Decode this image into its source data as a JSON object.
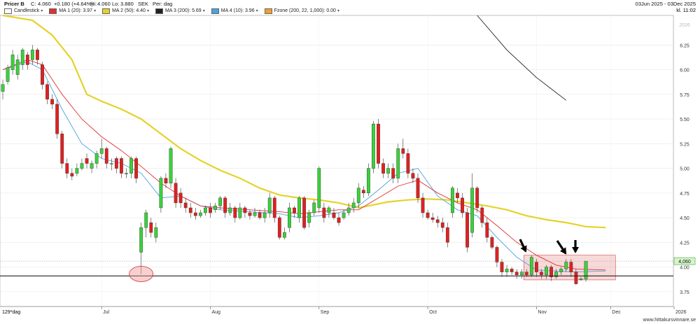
{
  "header": {
    "instrument": "Pricer B",
    "close_label": "C:",
    "close": "4.060",
    "change": "+0.180 (+4.64%)",
    "high_label": "Hi:",
    "high": "4.060",
    "low_label": "Lo:",
    "low": "3.880",
    "currency": "SEK",
    "period": "Per: dag",
    "date_range": "03Jun 2025 - 03Dec 2025",
    "time": "kl. 11:02"
  },
  "legend": [
    {
      "label": "Candlestick",
      "color": "#ffffff"
    },
    {
      "label": "MA 1 (20): 3.97",
      "color": "#e03030"
    },
    {
      "label": "MA 2 (50): 4.40",
      "color": "#e6d22a"
    },
    {
      "label": "MA 3 (200): 5.69",
      "color": "#222222"
    },
    {
      "label": "MA 4 (10): 3.96",
      "color": "#4aa3df"
    },
    {
      "label": "Fzone (200, 22, 1,000): 0.00",
      "color": "#f0a030"
    }
  ],
  "footer": {
    "range_label": "129*dag",
    "watermark": "www.hittakursvinnare.se"
  },
  "chart_data": {
    "type": "candlestick",
    "y_axis": {
      "ticks": [
        "6.25",
        "6.00",
        "5.75",
        "5.50",
        "5.25",
        "5.00",
        "4.75",
        "4.50",
        "4.25",
        "4.00",
        "3.75"
      ],
      "range": [
        3.6,
        6.55
      ],
      "top_label": "2026"
    },
    "x_axis": {
      "ticks": [
        "Jul",
        "Aug",
        "Sep",
        "Oct",
        "Nov",
        "Dec",
        "2026"
      ]
    },
    "last_price_label": "4,060",
    "support_level": 3.91,
    "colors": {
      "up": "#3ad13a",
      "down": "#e02020",
      "ma20": "#e03030",
      "ma50": "#e6d22a",
      "ma200": "#222222",
      "ma10": "#4aa3df"
    },
    "candles": [
      [
        5.78,
        5.85,
        5.7,
        5.9
      ],
      [
        5.88,
        6.02,
        5.85,
        6.05
      ],
      [
        6.0,
        6.15,
        5.95,
        6.2
      ],
      [
        5.95,
        6.1,
        5.9,
        6.15
      ],
      [
        6.05,
        6.2,
        6.0,
        6.22
      ],
      [
        6.15,
        6.05,
        6.0,
        6.18
      ],
      [
        6.1,
        6.2,
        6.05,
        6.25
      ],
      [
        6.2,
        6.1,
        6.05,
        6.22
      ],
      [
        6.05,
        5.85,
        5.8,
        6.08
      ],
      [
        5.85,
        5.7,
        5.65,
        5.88
      ],
      [
        5.7,
        5.65,
        5.6,
        5.75
      ],
      [
        5.65,
        5.35,
        5.3,
        5.7
      ],
      [
        5.35,
        5.05,
        5.0,
        5.38
      ],
      [
        5.05,
        4.95,
        4.9,
        5.1
      ],
      [
        4.95,
        4.92,
        4.88,
        5.0
      ],
      [
        4.95,
        5.0,
        4.92,
        5.05
      ],
      [
        5.0,
        5.05,
        4.98,
        5.1
      ],
      [
        5.1,
        5.05,
        5.0,
        5.15
      ],
      [
        5.0,
        5.05,
        4.95,
        5.08
      ],
      [
        5.05,
        5.15,
        5.0,
        5.18
      ],
      [
        5.15,
        5.2,
        5.1,
        5.3
      ],
      [
        5.2,
        5.05,
        5.0,
        5.22
      ],
      [
        5.05,
        5.05,
        4.98,
        5.1
      ],
      [
        5.1,
        5.0,
        4.95,
        5.12
      ],
      [
        5.1,
        4.95,
        4.9,
        5.12
      ],
      [
        4.95,
        4.95,
        4.9,
        5.0
      ],
      [
        4.95,
        5.1,
        4.9,
        5.12
      ],
      [
        5.1,
        4.9,
        4.85,
        5.12
      ],
      [
        4.15,
        4.4,
        3.93,
        4.45
      ],
      [
        4.4,
        4.55,
        4.3,
        4.58
      ],
      [
        4.45,
        4.35,
        4.3,
        4.5
      ],
      [
        4.3,
        4.4,
        4.25,
        4.45
      ],
      [
        4.6,
        4.9,
        4.55,
        4.92
      ],
      [
        4.9,
        4.85,
        4.8,
        4.95
      ],
      [
        4.85,
        5.2,
        4.8,
        5.22
      ],
      [
        4.85,
        4.65,
        4.6,
        4.9
      ],
      [
        4.75,
        4.65,
        4.6,
        4.8
      ],
      [
        4.65,
        4.6,
        4.55,
        4.7
      ],
      [
        4.6,
        4.55,
        4.5,
        4.65
      ],
      [
        4.55,
        4.52,
        4.48,
        4.6
      ],
      [
        4.52,
        4.55,
        4.5,
        4.58
      ],
      [
        4.55,
        4.6,
        4.52,
        4.62
      ],
      [
        4.6,
        4.55,
        4.5,
        4.65
      ],
      [
        4.58,
        4.62,
        4.55,
        4.65
      ],
      [
        4.62,
        4.7,
        4.58,
        4.72
      ],
      [
        4.7,
        4.55,
        4.5,
        4.72
      ],
      [
        4.55,
        4.6,
        4.52,
        4.65
      ],
      [
        4.6,
        4.5,
        4.45,
        4.62
      ],
      [
        4.5,
        4.6,
        4.48,
        4.65
      ],
      [
        4.6,
        4.55,
        4.5,
        4.62
      ],
      [
        4.55,
        4.52,
        4.48,
        4.58
      ],
      [
        4.52,
        4.55,
        4.5,
        4.6
      ],
      [
        4.55,
        4.5,
        4.48,
        4.58
      ],
      [
        4.5,
        4.55,
        4.45,
        4.6
      ],
      [
        4.55,
        4.7,
        4.5,
        4.75
      ],
      [
        4.7,
        4.5,
        4.45,
        4.72
      ],
      [
        4.5,
        4.3,
        4.28,
        4.52
      ],
      [
        4.3,
        4.35,
        4.28,
        4.4
      ],
      [
        4.4,
        4.6,
        4.35,
        4.65
      ],
      [
        4.6,
        4.55,
        4.5,
        4.62
      ],
      [
        4.5,
        4.7,
        4.45,
        4.72
      ],
      [
        4.7,
        4.4,
        4.38,
        4.72
      ],
      [
        4.45,
        4.55,
        4.4,
        4.58
      ],
      [
        4.55,
        4.65,
        4.52,
        4.68
      ],
      [
        4.6,
        5.0,
        4.55,
        5.02
      ],
      [
        4.6,
        4.5,
        4.45,
        4.65
      ],
      [
        4.55,
        4.6,
        4.5,
        4.62
      ],
      [
        4.55,
        4.5,
        4.48,
        4.6
      ],
      [
        4.5,
        4.45,
        4.42,
        4.55
      ],
      [
        4.5,
        4.55,
        4.48,
        4.58
      ],
      [
        4.55,
        4.6,
        4.52,
        4.65
      ],
      [
        4.6,
        4.65,
        4.55,
        4.7
      ],
      [
        4.65,
        4.8,
        4.6,
        4.85
      ],
      [
        4.78,
        4.75,
        4.7,
        4.82
      ],
      [
        4.75,
        5.0,
        4.72,
        5.05
      ],
      [
        5.0,
        5.45,
        4.95,
        5.48
      ],
      [
        5.45,
        5.05,
        5.0,
        5.5
      ],
      [
        5.05,
        4.95,
        4.9,
        5.1
      ],
      [
        4.95,
        5.0,
        4.9,
        5.05
      ],
      [
        5.0,
        4.9,
        4.85,
        5.05
      ],
      [
        4.9,
        5.2,
        4.85,
        5.25
      ],
      [
        5.2,
        5.15,
        5.1,
        5.3
      ],
      [
        5.15,
        4.95,
        4.9,
        5.2
      ],
      [
        4.95,
        4.9,
        4.85,
        5.0
      ],
      [
        4.9,
        4.7,
        4.65,
        4.95
      ],
      [
        4.7,
        4.55,
        4.5,
        4.75
      ],
      [
        4.55,
        4.5,
        4.48,
        4.58
      ],
      [
        4.5,
        4.48,
        4.45,
        4.55
      ],
      [
        4.48,
        4.45,
        4.4,
        4.52
      ],
      [
        4.45,
        4.4,
        4.35,
        4.5
      ],
      [
        4.4,
        4.25,
        4.2,
        4.45
      ],
      [
        4.55,
        4.8,
        4.5,
        4.82
      ],
      [
        4.75,
        4.7,
        4.65,
        4.8
      ],
      [
        4.7,
        4.55,
        4.5,
        4.75
      ],
      [
        4.55,
        4.2,
        4.15,
        4.6
      ],
      [
        4.35,
        4.8,
        4.3,
        4.95
      ],
      [
        4.8,
        4.6,
        4.55,
        4.82
      ],
      [
        4.6,
        4.45,
        4.4,
        4.62
      ],
      [
        4.45,
        4.3,
        4.25,
        4.5
      ],
      [
        4.3,
        4.2,
        4.18,
        4.32
      ],
      [
        4.2,
        4.05,
        4.0,
        4.22
      ],
      [
        4.05,
        3.95,
        3.9,
        4.08
      ],
      [
        3.95,
        3.98,
        3.9,
        4.02
      ],
      [
        3.98,
        3.95,
        3.92,
        4.0
      ],
      [
        3.95,
        3.92,
        3.88,
        3.98
      ],
      [
        3.92,
        3.95,
        3.88,
        3.98
      ],
      [
        3.95,
        3.92,
        3.9,
        3.98
      ],
      [
        3.92,
        4.1,
        3.9,
        4.12
      ],
      [
        4.05,
        3.95,
        3.9,
        4.08
      ],
      [
        3.95,
        3.92,
        3.88,
        3.98
      ],
      [
        3.92,
        4.0,
        3.88,
        4.02
      ],
      [
        4.0,
        3.9,
        3.86,
        4.02
      ],
      [
        3.9,
        3.95,
        3.88,
        3.98
      ],
      [
        3.95,
        3.98,
        3.92,
        4.0
      ],
      [
        3.98,
        4.05,
        3.95,
        4.08
      ],
      [
        4.05,
        3.95,
        3.9,
        4.08
      ],
      [
        3.95,
        3.83,
        3.82,
        3.98
      ],
      [
        3.88,
        3.88,
        3.86,
        3.9
      ],
      [
        3.88,
        4.06,
        3.85,
        4.06
      ]
    ],
    "ma20": [
      [
        0,
        6.0
      ],
      [
        5,
        6.1
      ],
      [
        8,
        6.05
      ],
      [
        12,
        5.75
      ],
      [
        16,
        5.5
      ],
      [
        20,
        5.32
      ],
      [
        24,
        5.18
      ],
      [
        28,
        5.02
      ],
      [
        32,
        4.85
      ],
      [
        36,
        4.72
      ],
      [
        40,
        4.62
      ],
      [
        44,
        4.6
      ],
      [
        50,
        4.58
      ],
      [
        56,
        4.56
      ],
      [
        60,
        4.54
      ],
      [
        64,
        4.56
      ],
      [
        68,
        4.58
      ],
      [
        72,
        4.58
      ],
      [
        76,
        4.7
      ],
      [
        80,
        4.82
      ],
      [
        84,
        4.88
      ],
      [
        88,
        4.75
      ],
      [
        92,
        4.65
      ],
      [
        96,
        4.58
      ],
      [
        100,
        4.42
      ],
      [
        104,
        4.25
      ],
      [
        108,
        4.12
      ],
      [
        112,
        4.02
      ],
      [
        116,
        3.98
      ],
      [
        122,
        3.97
      ]
    ],
    "ma50": [
      [
        0,
        6.55
      ],
      [
        6,
        6.5
      ],
      [
        10,
        6.35
      ],
      [
        14,
        6.1
      ],
      [
        17,
        5.75
      ],
      [
        20,
        5.68
      ],
      [
        24,
        5.6
      ],
      [
        28,
        5.5
      ],
      [
        32,
        5.35
      ],
      [
        36,
        5.2
      ],
      [
        40,
        5.08
      ],
      [
        44,
        4.98
      ],
      [
        48,
        4.9
      ],
      [
        52,
        4.8
      ],
      [
        56,
        4.73
      ],
      [
        60,
        4.7
      ],
      [
        64,
        4.68
      ],
      [
        68,
        4.65
      ],
      [
        72,
        4.6
      ],
      [
        74,
        4.62
      ],
      [
        78,
        4.66
      ],
      [
        82,
        4.68
      ],
      [
        86,
        4.69
      ],
      [
        90,
        4.68
      ],
      [
        94,
        4.65
      ],
      [
        98,
        4.62
      ],
      [
        102,
        4.58
      ],
      [
        106,
        4.52
      ],
      [
        110,
        4.48
      ],
      [
        114,
        4.45
      ],
      [
        118,
        4.41
      ],
      [
        122,
        4.4
      ]
    ],
    "ma200": [
      [
        96,
        6.55
      ],
      [
        102,
        6.2
      ],
      [
        108,
        5.92
      ],
      [
        114,
        5.69
      ]
    ],
    "ma10": [
      [
        0,
        6.0
      ],
      [
        5,
        6.08
      ],
      [
        8,
        6.0
      ],
      [
        12,
        5.6
      ],
      [
        16,
        5.25
      ],
      [
        20,
        5.1
      ],
      [
        24,
        5.05
      ],
      [
        28,
        4.95
      ],
      [
        32,
        4.7
      ],
      [
        36,
        4.72
      ],
      [
        40,
        4.62
      ],
      [
        44,
        4.58
      ],
      [
        50,
        4.56
      ],
      [
        56,
        4.54
      ],
      [
        60,
        4.5
      ],
      [
        64,
        4.52
      ],
      [
        68,
        4.55
      ],
      [
        72,
        4.62
      ],
      [
        76,
        4.78
      ],
      [
        80,
        4.95
      ],
      [
        84,
        5.0
      ],
      [
        88,
        4.72
      ],
      [
        92,
        4.58
      ],
      [
        96,
        4.52
      ],
      [
        100,
        4.3
      ],
      [
        104,
        4.1
      ],
      [
        108,
        3.97
      ],
      [
        112,
        3.96
      ],
      [
        116,
        3.95
      ],
      [
        122,
        3.96
      ]
    ]
  }
}
